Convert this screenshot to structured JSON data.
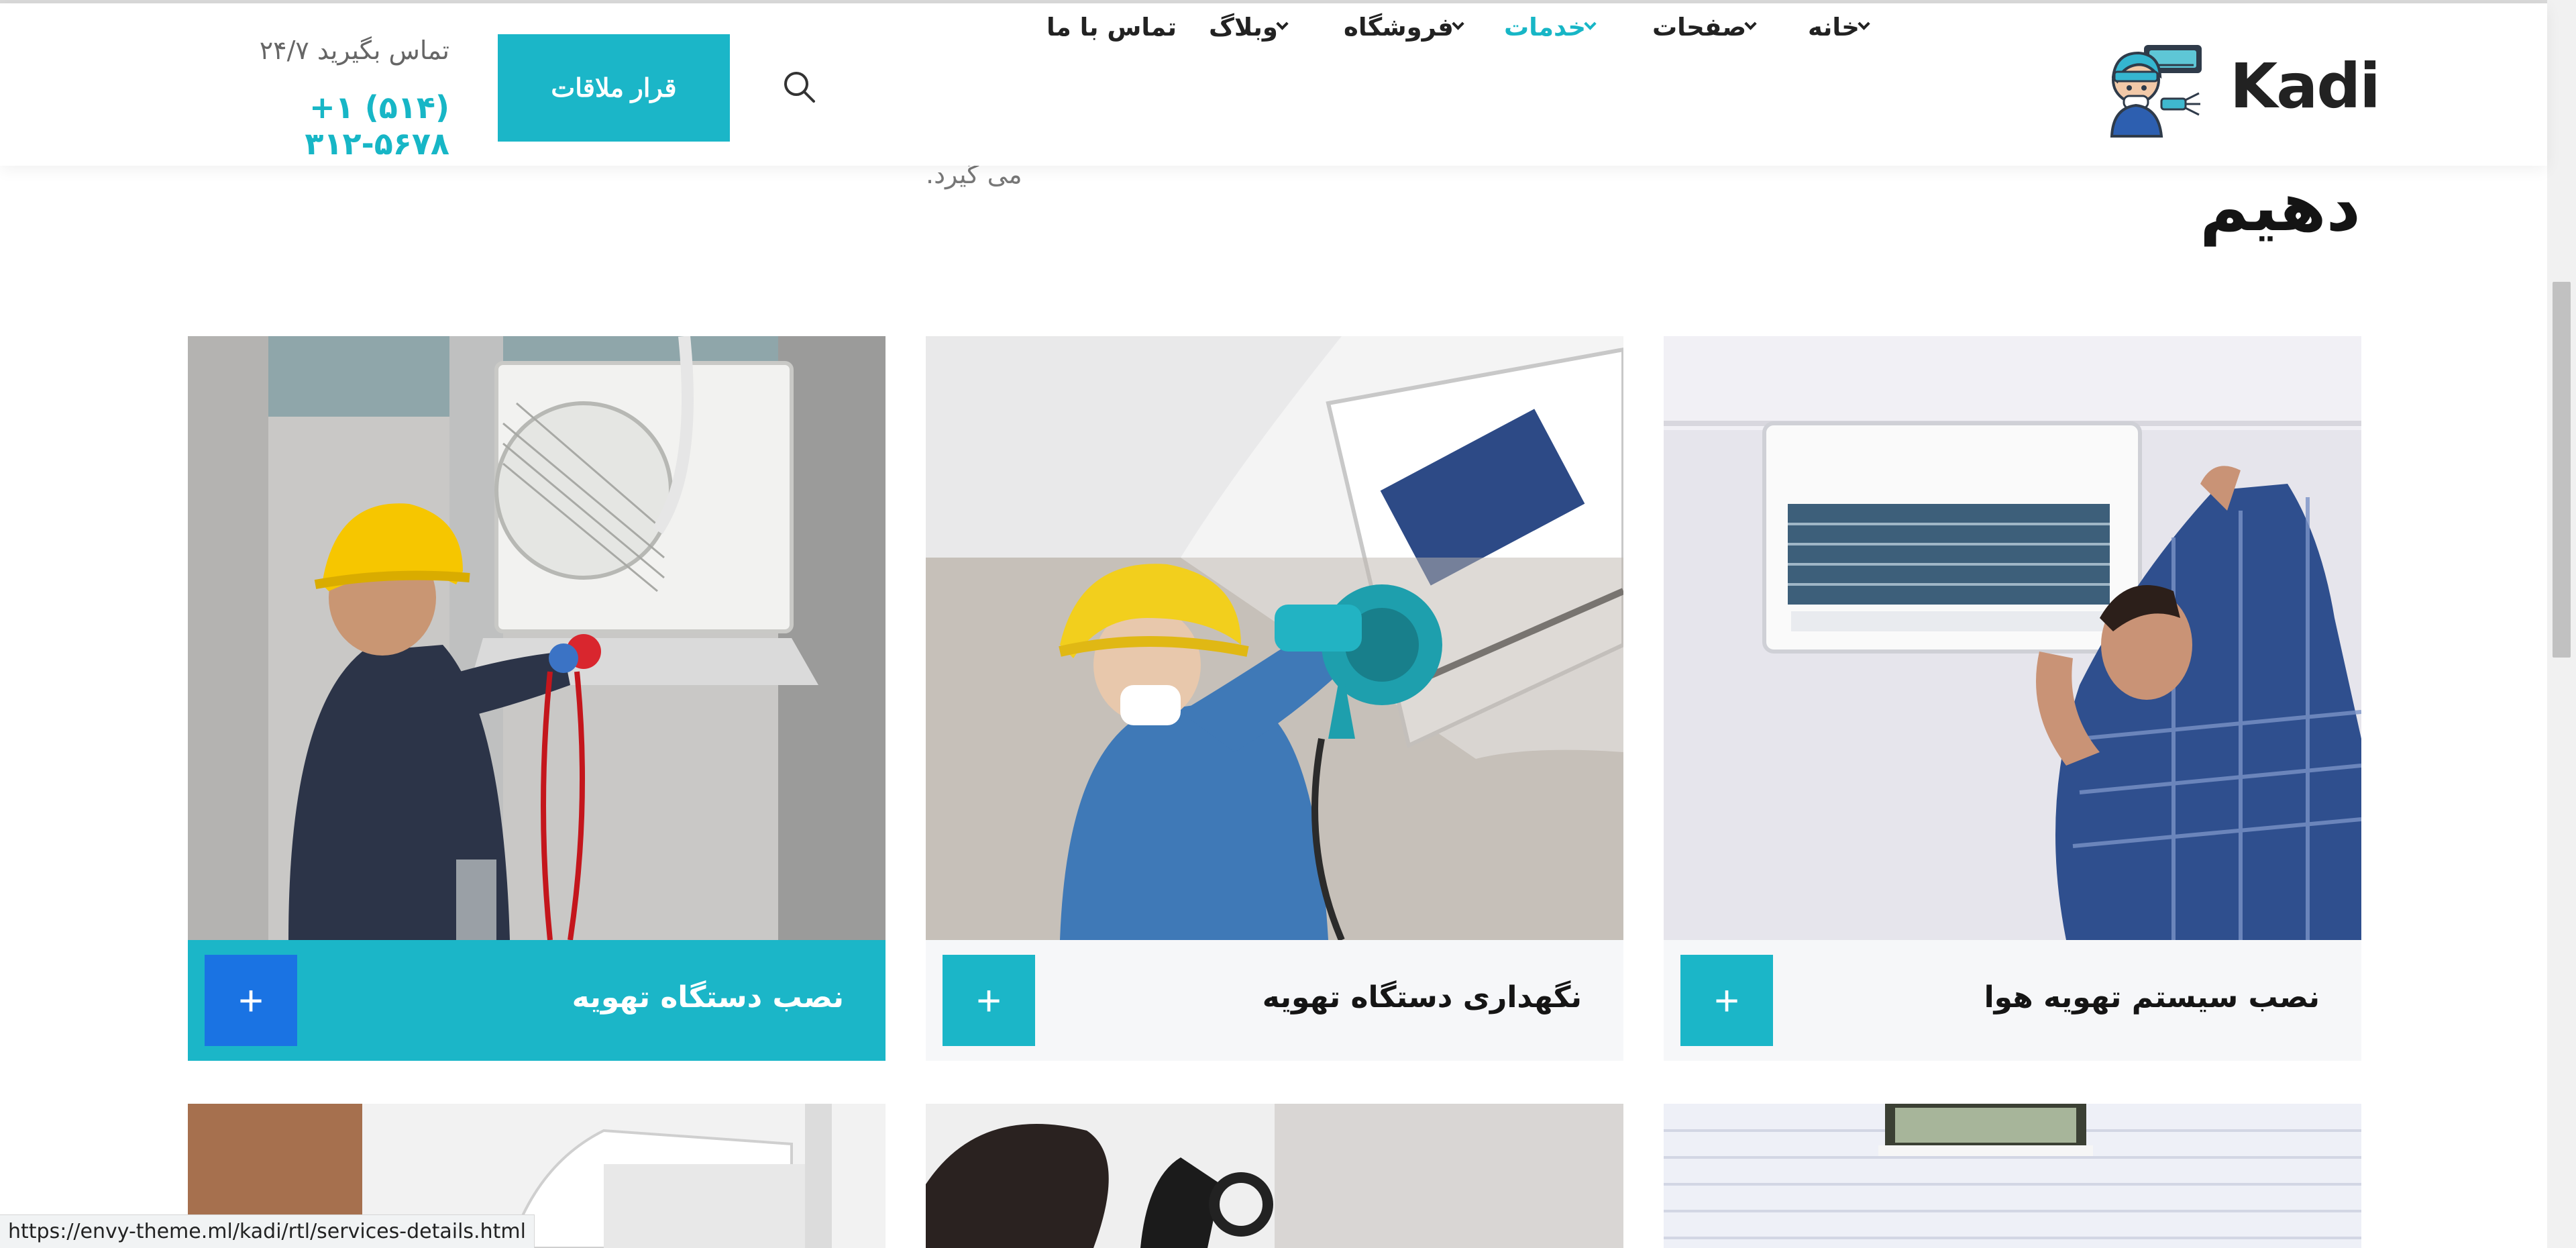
{
  "header": {
    "brand": "Kadi",
    "nav": [
      {
        "label": "خانه",
        "has_dropdown": true,
        "active": false
      },
      {
        "label": "صفحات",
        "has_dropdown": true,
        "active": false
      },
      {
        "label": "خدمات",
        "has_dropdown": true,
        "active": true
      },
      {
        "label": "فروشگاه",
        "has_dropdown": true,
        "active": false
      },
      {
        "label": "وبلاگ",
        "has_dropdown": true,
        "active": false
      },
      {
        "label": "تماس با ما",
        "has_dropdown": false,
        "active": false
      }
    ],
    "cta_label": "قرار ملاقات",
    "contact_label": "تماس بگیرید ۲۴/۷",
    "contact_phone": "+۱ (۵۱۴) ۳۱۲-۵۶۷۸"
  },
  "section": {
    "heading_tail": "دهیم",
    "desc_tail": "می گیرد."
  },
  "services": [
    {
      "title": "نصب سیستم تهویه هوا",
      "plus": "+"
    },
    {
      "title": "نگهداری دستگاه تهویه",
      "plus": "+"
    },
    {
      "title": "نصب دستگاه تهویه",
      "plus": "+"
    }
  ],
  "status_url": "https://envy-theme.ml/kadi/rtl/services-details.html",
  "colors": {
    "accent": "#1bb6c8",
    "accent_blue": "#1a73e3",
    "text_dark": "#151515",
    "card_bar": "#f6f7f9"
  }
}
